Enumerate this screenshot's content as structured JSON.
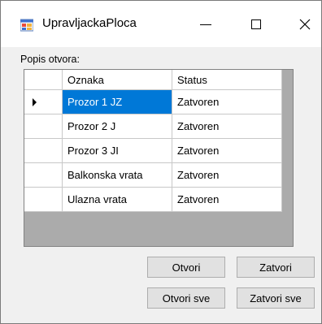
{
  "window": {
    "title": "UpravljackaPloca",
    "icon": "windows-form-icon"
  },
  "controls": {
    "minimize": "minimize-icon",
    "maximize": "maximize-icon",
    "close": "×"
  },
  "main": {
    "section_label": "Popis otvora:",
    "grid": {
      "columns": [
        "Oznaka",
        "Status"
      ],
      "rows": [
        {
          "oznaka": "Prozor 1 JZ",
          "status": "Zatvoren",
          "current": true
        },
        {
          "oznaka": "Prozor 2 J",
          "status": "Zatvoren"
        },
        {
          "oznaka": "Prozor 3 JI",
          "status": "Zatvoren"
        },
        {
          "oznaka": "Balkonska vrata",
          "status": "Zatvoren"
        },
        {
          "oznaka": "Ulazna vrata",
          "status": "Zatvoren"
        }
      ]
    },
    "buttons": {
      "otvori": "Otvori",
      "zatvori": "Zatvori",
      "otvori_sve": "Otvori sve",
      "zatvori_sve": "Zatvori sve"
    }
  },
  "colors": {
    "selection": "#0078d7",
    "grid_background": "#ababab"
  }
}
